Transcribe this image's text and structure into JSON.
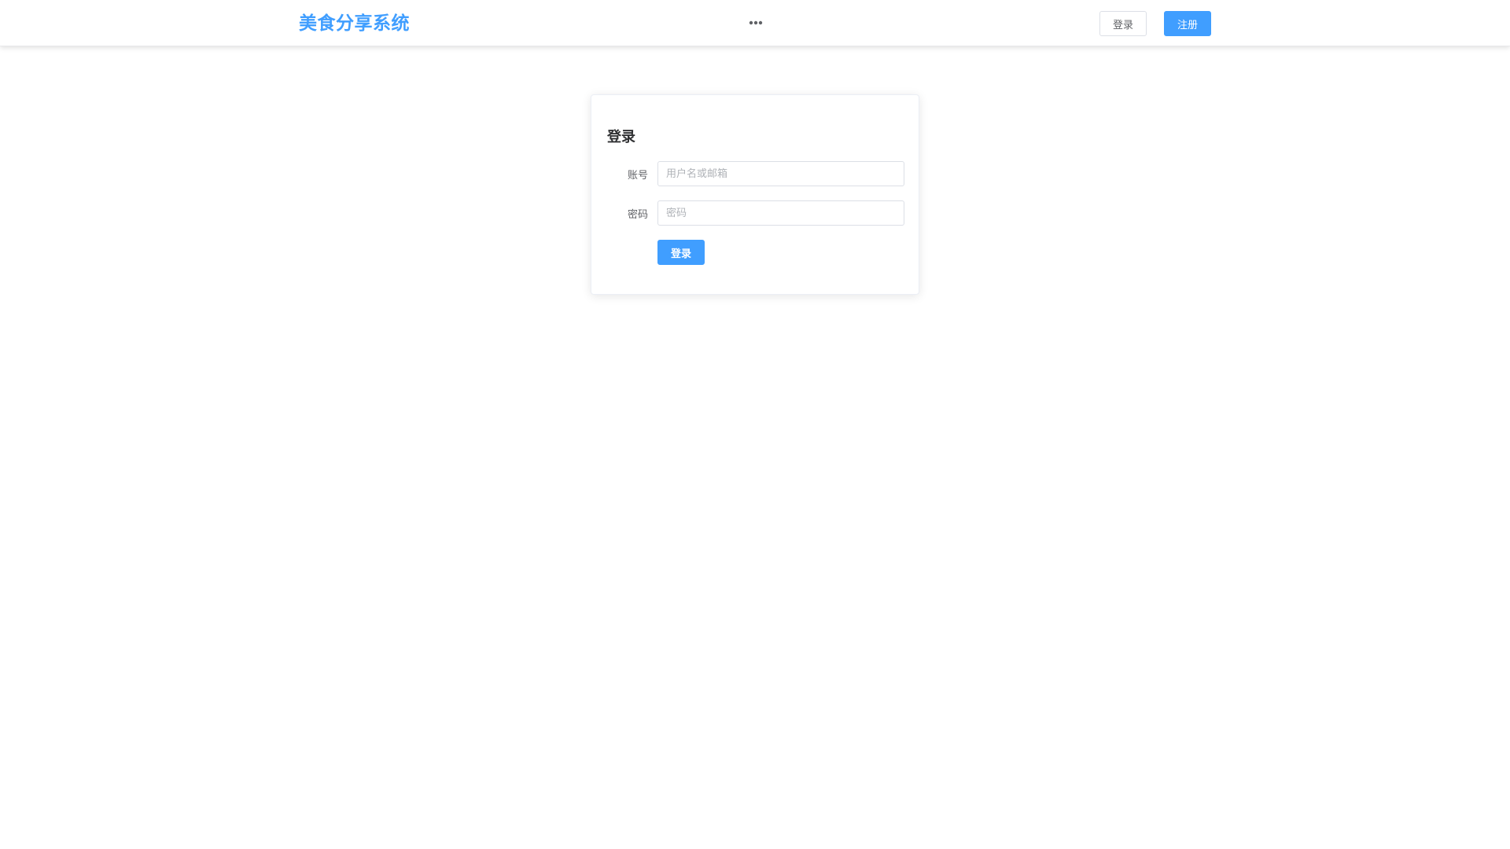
{
  "header": {
    "logo": "美食分享系统",
    "more_icon": "more-horizontal-icon",
    "login_label": "登录",
    "register_label": "注册"
  },
  "login_card": {
    "title": "登录",
    "account_label": "账号",
    "account_placeholder": "用户名或邮箱",
    "account_value": "",
    "password_label": "密码",
    "password_placeholder": "密码",
    "password_value": "",
    "submit_label": "登录"
  },
  "colors": {
    "primary": "#409eff",
    "text": "#303133",
    "border": "#dcdfe6"
  }
}
